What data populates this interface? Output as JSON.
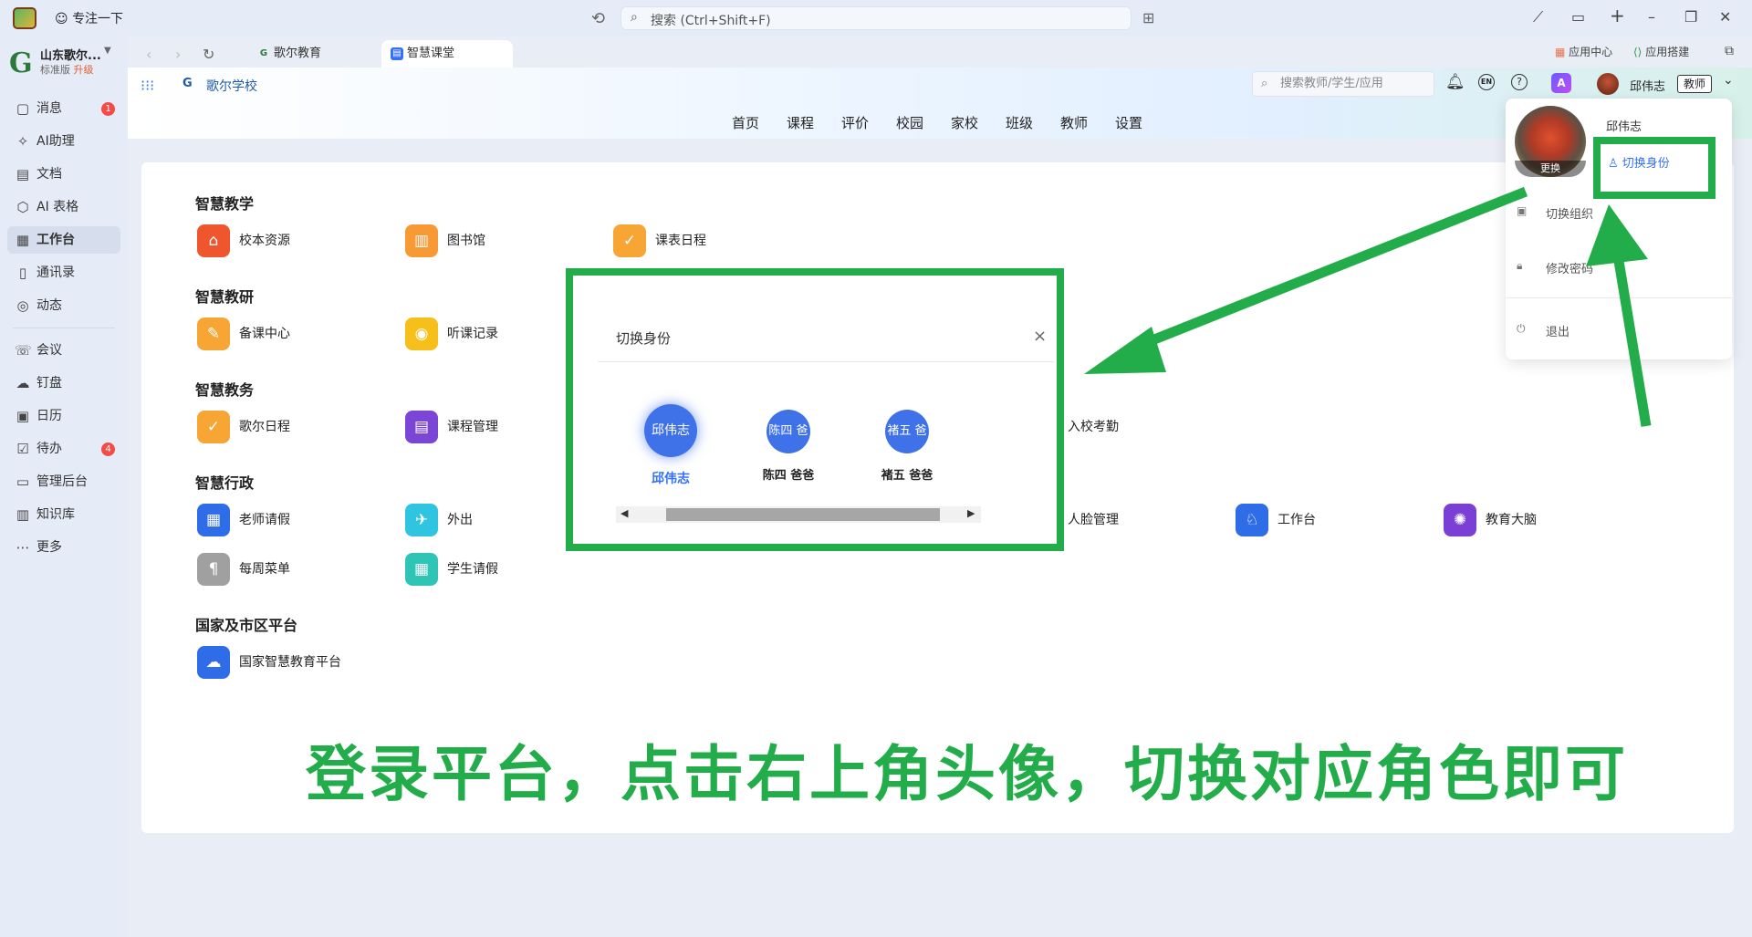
{
  "titlebar": {
    "focus_label": "专注一下",
    "search_placeholder": "搜索 (Ctrl+Shift+F)"
  },
  "org": {
    "name": "山东歌尔...",
    "plan": "标准版",
    "upgrade": "升级"
  },
  "sidebar": {
    "items": [
      {
        "label": "消息",
        "icon": "message-icon",
        "badge": "1"
      },
      {
        "label": "AI助理",
        "icon": "ai-assistant-icon"
      },
      {
        "label": "文档",
        "icon": "doc-icon"
      },
      {
        "label": "AI 表格",
        "icon": "ai-table-icon"
      },
      {
        "label": "工作台",
        "icon": "workbench-icon",
        "active": true
      },
      {
        "label": "通讯录",
        "icon": "contacts-icon"
      },
      {
        "label": "动态",
        "icon": "feed-icon"
      },
      {
        "label": "会议",
        "icon": "meeting-icon"
      },
      {
        "label": "钉盘",
        "icon": "drive-icon"
      },
      {
        "label": "日历",
        "icon": "calendar-icon"
      },
      {
        "label": "待办",
        "icon": "todo-icon",
        "badge": "4"
      },
      {
        "label": "管理后台",
        "icon": "admin-icon"
      },
      {
        "label": "知识库",
        "icon": "knowledge-icon"
      },
      {
        "label": "更多",
        "icon": "more-icon"
      }
    ]
  },
  "tabs": [
    {
      "label": "歌尔教育"
    },
    {
      "label": "智慧课堂",
      "active": true
    }
  ],
  "right_links": {
    "app_center": "应用中心",
    "app_builder": "应用搭建"
  },
  "web": {
    "school_name": "歌尔学校",
    "search_placeholder": "搜索教师/学生/应用",
    "lang": "EN",
    "user_name": "邱伟志",
    "user_role": "教师",
    "main_nav": [
      "首页",
      "课程",
      "评价",
      "校园",
      "家校",
      "班级",
      "教师",
      "设置"
    ]
  },
  "sections": [
    {
      "title": "智慧教学",
      "apps": [
        "校本资源",
        "图书馆",
        "课表日程"
      ]
    },
    {
      "title": "智慧教研",
      "apps": [
        "备课中心",
        "听课记录"
      ]
    },
    {
      "title": "智慧教务",
      "apps": [
        "歌尔日程",
        "课程管理",
        "入校考勤"
      ]
    },
    {
      "title": "智慧行政",
      "apps": [
        "老师请假",
        "外出",
        "人脸管理",
        "工作台",
        "教育大脑",
        "每周菜单",
        "学生请假"
      ]
    },
    {
      "title": "国家及市区平台",
      "apps": [
        "国家智慧教育平台"
      ]
    }
  ],
  "dialog": {
    "title": "切换身份",
    "roles": [
      {
        "circle": "邱伟志",
        "name": "邱伟志",
        "selected": true
      },
      {
        "circle": "陈四 爸",
        "name": "陈四 爸爸"
      },
      {
        "circle": "褚五 爸",
        "name": "褚五 爸爸"
      }
    ]
  },
  "popup": {
    "avatar_change": "更换",
    "name": "邱伟志",
    "switch_identity": "切换身份",
    "switch_org": "切换组织",
    "change_password": "修改密码",
    "logout": "退出"
  },
  "caption": "登录平台，点击右上角头像，切换对应角色即可",
  "colors": {
    "accent": "#3370ff",
    "annotation_green": "#22ad4a",
    "role_blue": "#3f72e8"
  }
}
